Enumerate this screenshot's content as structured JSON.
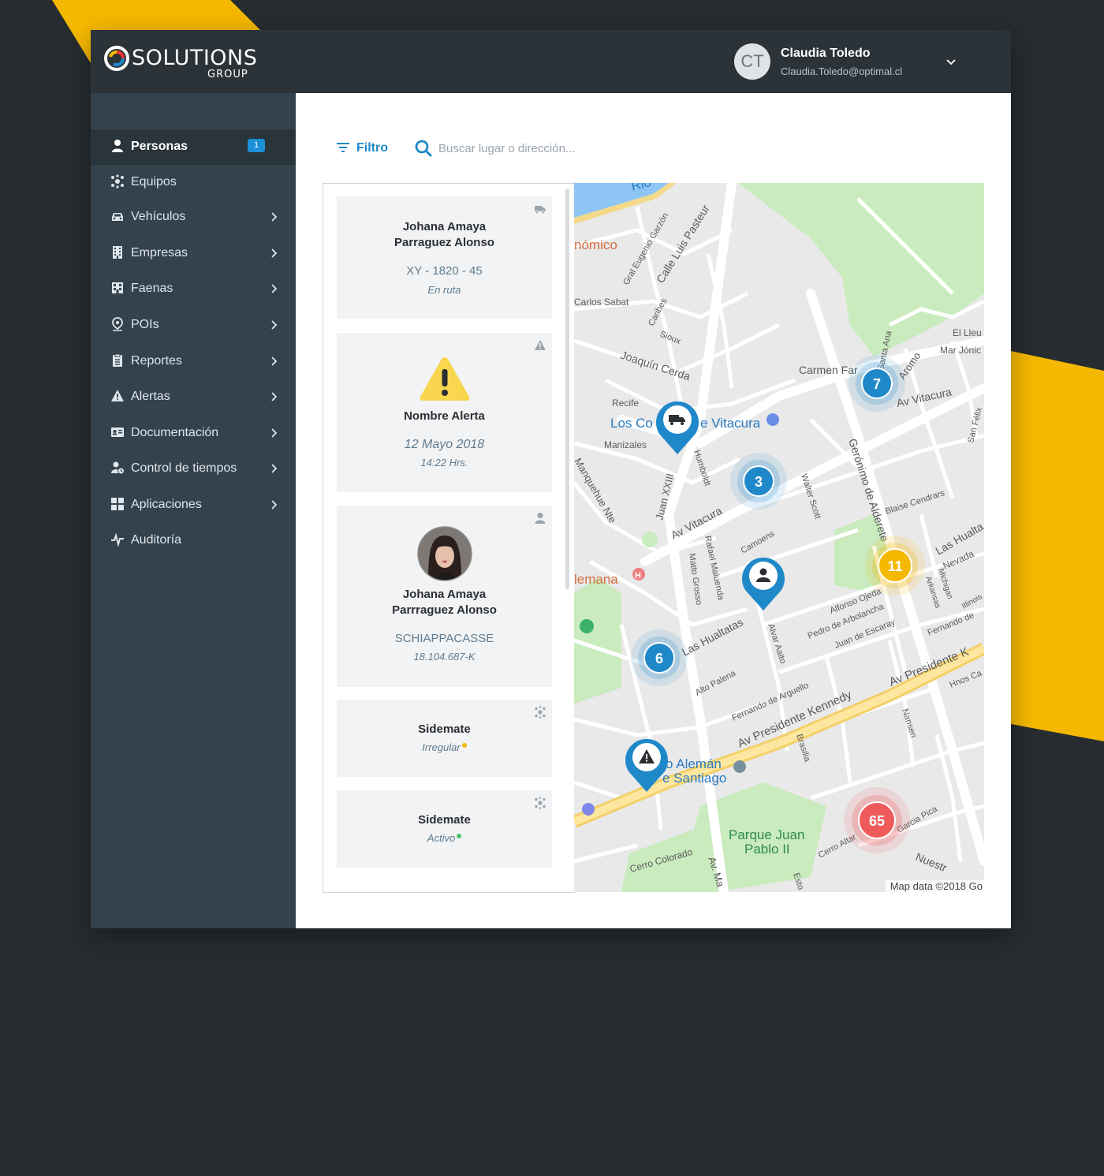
{
  "brand": {
    "logo_word": "SOLUTIONS",
    "logo_sub": "GROUP",
    "accent": "#f5b800",
    "primary": "#1f88c9"
  },
  "user": {
    "initials": "CT",
    "name": "Claudia Toledo",
    "email": "Claudia.Toledo@optimal.cl"
  },
  "sidebar": {
    "items": [
      {
        "label": "Personas",
        "badge": "1",
        "active": true,
        "icon": "person-icon"
      },
      {
        "label": "Equipos",
        "icon": "team-icon"
      },
      {
        "label": "Vehículos",
        "icon": "car-icon"
      },
      {
        "label": "Empresas",
        "icon": "building-icon"
      },
      {
        "label": "Faenas",
        "icon": "factory-icon"
      },
      {
        "label": "POIs",
        "icon": "location-pin-icon"
      },
      {
        "label": "Reportes",
        "icon": "clipboard-icon"
      },
      {
        "label": "Alertas",
        "icon": "warning-icon"
      },
      {
        "label": "Documentación",
        "icon": "id-card-icon"
      },
      {
        "label": "Control de tiempos",
        "icon": "user-clock-icon"
      },
      {
        "label": "Aplicaciones",
        "icon": "grid-icon"
      },
      {
        "label": "Auditoría",
        "icon": "pulse-icon"
      }
    ]
  },
  "toolbar": {
    "filter_label": "Filtro",
    "search_placeholder": "Buscar lugar o dirección..."
  },
  "cards": [
    {
      "type": "vehicle",
      "name_line1": "Johana Amaya",
      "name_line2": "Parraguez Alonso",
      "plate": "XY - 1820 - 45",
      "status": "En ruta"
    },
    {
      "type": "alert",
      "title": "Nombre Alerta",
      "date": "12 Mayo 2018",
      "time": "14:22 Hrs."
    },
    {
      "type": "person",
      "name_line1": "Johana Amaya",
      "name_line2": "Parrraguez Alonso",
      "company": "SCHIAPPACASSE",
      "rut": "18.104.687-K"
    },
    {
      "type": "team",
      "name": "Sidemate",
      "status": "Irregular",
      "status_color": "#f5b800"
    },
    {
      "type": "team",
      "name": "Sidemate",
      "status": "Activo",
      "status_color": "#4cc36a"
    }
  ],
  "map": {
    "credit": "Map data ©2018 Go",
    "street_labels": [
      "Calle Luis Pasteur",
      "Gral Eugenio Garzón",
      "Carlos Sabat",
      "Caribes",
      "Sioux",
      "Joaquín Cerda",
      "Carmen Far",
      "Aromo",
      "Av Vitacura",
      "Recife",
      "Manizales",
      "Manquehue Nte",
      "Juan XXIII",
      "Humboldt",
      "Walter Scott",
      "Gerónimo de Alderete",
      "Blaise Cendrars",
      "Las Hualta",
      "Nevada",
      "Av Vitacura",
      "Rafael Maluenda",
      "Matto Grosso",
      "Camoens",
      "Alvar Aalto",
      "Alfonso Ojeda",
      "Pedro de Arbolancha",
      "Juan de Escaray",
      "Arkansas",
      "Michigan",
      "Illinois",
      "Fernando de",
      "Las Hualtatas",
      "Alto Palena",
      "Fernando de Arguello",
      "Av Presidente Kennedy",
      "Av Presidente K",
      "Nansen",
      "Hnos Ca",
      "Brasilia",
      "Cerro Colorado",
      "Av. Ma",
      "Cerro Altar",
      "Garcia Pica",
      "Nuestr",
      "Esto",
      "San Félix",
      "El Lleu",
      "Mar Jónic",
      "Santa Ana"
    ],
    "place_labels": [
      "nómico",
      "Los Co",
      "e Vitacura",
      "lemana",
      "o Alemán",
      "e Santiago",
      "Parque Juan",
      "Pablo II",
      "Rio"
    ],
    "clusters": [
      {
        "count": "7",
        "color": "#1f88c9"
      },
      {
        "count": "3",
        "color": "#1f88c9"
      },
      {
        "count": "11",
        "color": "#f5b800"
      },
      {
        "count": "6",
        "color": "#1f88c9"
      },
      {
        "count": "65",
        "color": "#ef5a5a"
      }
    ],
    "markers": [
      {
        "icon": "truck-icon"
      },
      {
        "icon": "person-icon"
      },
      {
        "icon": "warning-icon"
      }
    ]
  }
}
